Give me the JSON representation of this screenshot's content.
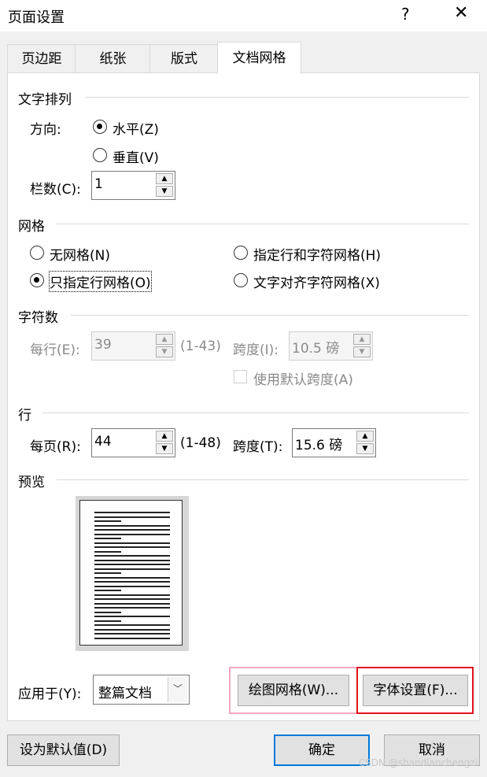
{
  "window": {
    "title": "页面设置",
    "help": "?",
    "close": "✕"
  },
  "tabs": [
    "页边距",
    "纸张",
    "版式",
    "文档网格"
  ],
  "text_direction": {
    "heading": "文字排列",
    "direction_label": "方向:",
    "horizontal": "水平(Z)",
    "vertical": "垂直(V)",
    "columns_label": "栏数(C):",
    "columns_value": "1"
  },
  "grid": {
    "heading": "网格",
    "none": "无网格(N)",
    "line_only": "只指定行网格(O)",
    "line_and_char": "指定行和字符网格(H)",
    "snap_char": "文字对齐字符网格(X)"
  },
  "chars": {
    "heading": "字符数",
    "per_line_label": "每行(E):",
    "per_line_value": "39",
    "per_line_range": "(1-43)",
    "pitch_label": "跨度(I):",
    "pitch_value": "10.5 磅",
    "default_pitch": "使用默认跨度(A)"
  },
  "lines": {
    "heading": "行",
    "per_page_label": "每页(R):",
    "per_page_value": "44",
    "per_page_range": "(1-48)",
    "pitch_label": "跨度(T):",
    "pitch_value": "15.6 磅"
  },
  "preview": {
    "heading": "预览"
  },
  "apply_to": {
    "label": "应用于(Y):",
    "value": "整篇文档"
  },
  "buttons": {
    "draw_grid": "绘图网格(W)...",
    "font_settings": "字体设置(F)...",
    "set_default": "设为默认值(D)",
    "ok": "确定",
    "cancel": "取消"
  },
  "watermark": "CSDN @shandianchengzi",
  "colors": {
    "highlight_pink": "#f3a7c0",
    "highlight_red": "#e0141e",
    "primary_border": "#0078d7"
  }
}
